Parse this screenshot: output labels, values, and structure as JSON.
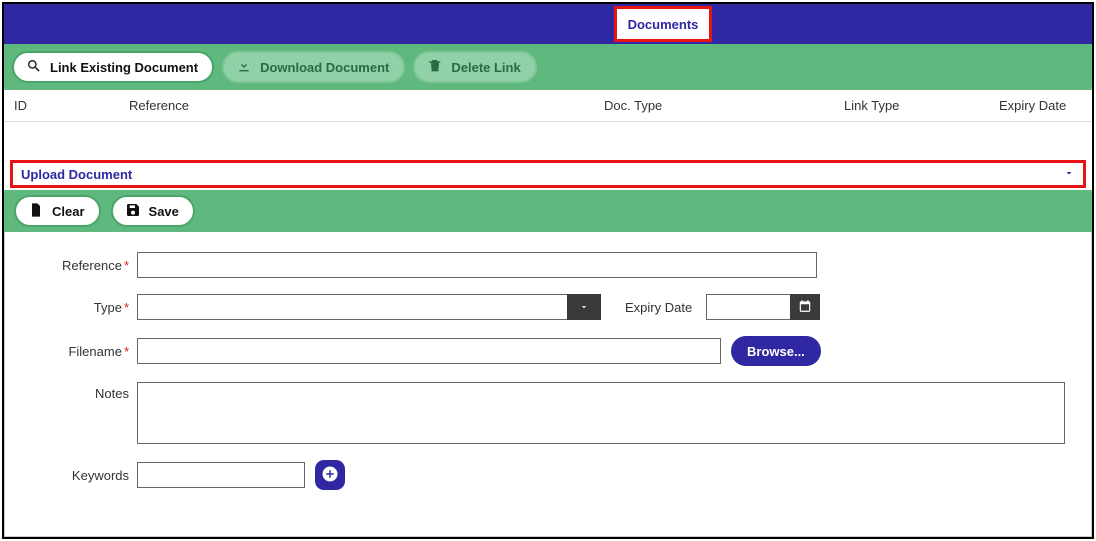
{
  "header": {
    "tab": "Documents"
  },
  "toolbar1": {
    "link_existing": "Link Existing Document",
    "download": "Download Document",
    "delete_link": "Delete Link"
  },
  "table": {
    "cols": {
      "id": "ID",
      "reference": "Reference",
      "doc_type": "Doc. Type",
      "link_type": "Link Type",
      "expiry_date": "Expiry Date"
    }
  },
  "section": {
    "title": "Upload Document"
  },
  "toolbar2": {
    "clear": "Clear",
    "save": "Save"
  },
  "form": {
    "labels": {
      "reference": "Reference",
      "type": "Type",
      "expiry_date": "Expiry Date",
      "filename": "Filename",
      "notes": "Notes",
      "keywords": "Keywords"
    },
    "browse": "Browse...",
    "values": {
      "reference": "",
      "type": "",
      "expiry_date": "",
      "filename": "",
      "notes": "",
      "keywords": ""
    }
  }
}
